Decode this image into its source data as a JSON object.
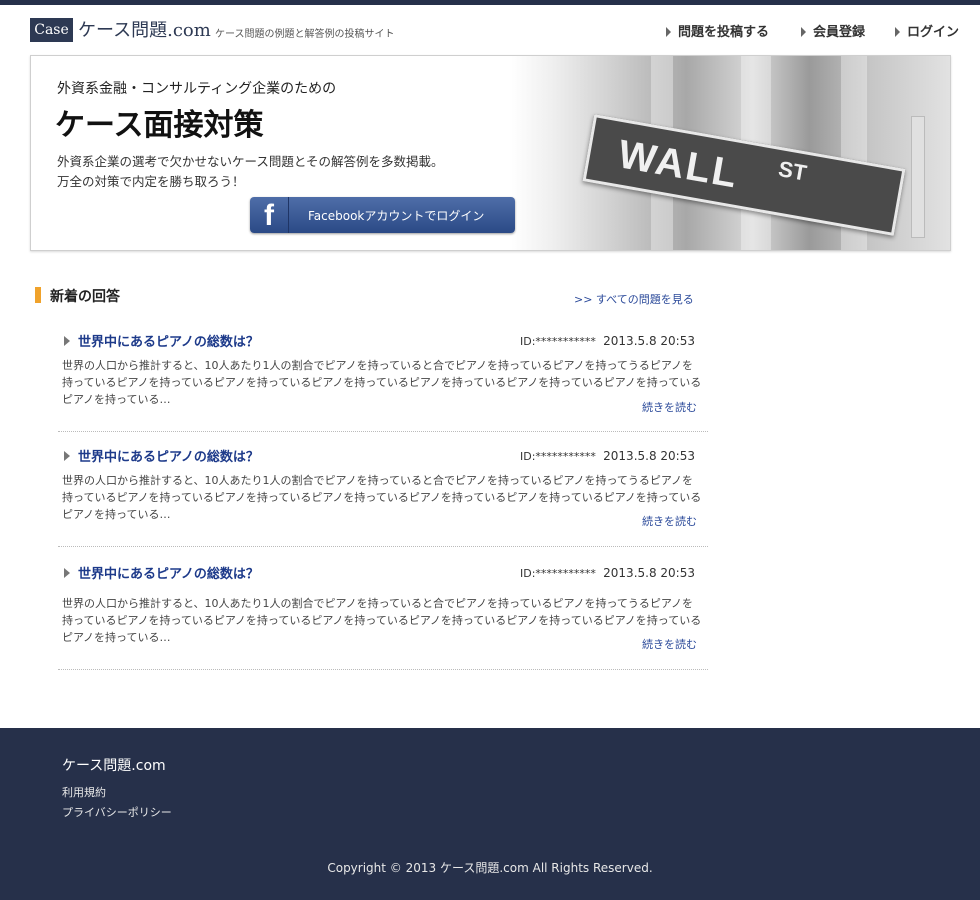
{
  "header": {
    "logo_box": "Case",
    "logo_text": "ケース問題.com",
    "tagline": "ケース問題の例題と解答例の投稿サイト",
    "nav": [
      "問題を投稿する",
      "会員登録",
      "ログイン"
    ]
  },
  "hero": {
    "subtitle": "外資系金融・コンサルティング企業のための",
    "title": "ケース面接対策",
    "desc_line1": "外資系企業の選考で欠かせないケース問題とその解答例を多数掲載。",
    "desc_line2": "万全の対策で内定を勝ち取ろう！",
    "fb_icon": "f",
    "fb_button": "Facebookアカウントでログイン",
    "sign_wall": "WALL",
    "sign_st": "ST"
  },
  "section": {
    "title": "新着の回答",
    "see_all": ">> すべての問題を見る"
  },
  "entries": [
    {
      "question": "世界中にあるピアノの総数は？",
      "user_id": "ID:***********",
      "date": "2013.5.8  20:53",
      "body": "世界の人口から推計すると、10人あたり1人の割合でピアノを持っていると合でピアノを持っているピアノを持ってうるピアノを持っているピアノを持っているピアノを持っているピアノを持っているピアノを持っているピアノを持っているピアノを持っているピアノを持っている…",
      "more": "続きを読む"
    },
    {
      "question": "世界中にあるピアノの総数は？",
      "user_id": "ID:***********",
      "date": "2013.5.8  20:53",
      "body": "世界の人口から推計すると、10人あたり1人の割合でピアノを持っていると合でピアノを持っているピアノを持ってうるピアノを持っているピアノを持っているピアノを持っているピアノを持っているピアノを持っているピアノを持っているピアノを持っているピアノを持っている…",
      "more": "続きを読む"
    },
    {
      "question": "世界中にあるピアノの総数は？",
      "user_id": "ID:***********",
      "date": "2013.5.8  20:53",
      "body": "世界の人口から推計すると、10人あたり1人の割合でピアノを持っていると合でピアノを持っているピアノを持ってうるピアノを持っているピアノを持っているピアノを持っているピアノを持っているピアノを持っているピアノを持っているピアノを持っているピアノを持っている…",
      "more": "続きを読む"
    }
  ],
  "footer": {
    "title": "ケース問題.com",
    "links": [
      "利用規約",
      "プライバシーポリシー"
    ],
    "copyright": "Copyright © 2013 ケース問題.com All Rights Reserved."
  },
  "colors": {
    "navy": "#26304a",
    "accent": "#f0a22b",
    "link": "#2b4a9a",
    "facebook": "#3b5998"
  }
}
